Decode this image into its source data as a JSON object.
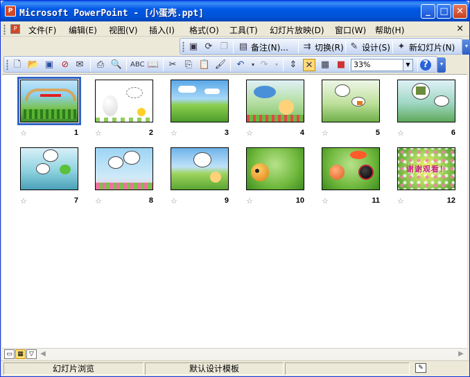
{
  "window": {
    "title": "Microsoft PowerPoint - [小蛋壳.ppt]",
    "icon": "powerpoint-icon",
    "controls": {
      "minimize": "_",
      "maximize": "□",
      "close": "✕"
    }
  },
  "menubar": {
    "items": [
      {
        "label": "文件(F)"
      },
      {
        "label": "编辑(E)"
      },
      {
        "label": "视图(V)"
      },
      {
        "label": "插入(I)"
      },
      {
        "label": "格式(O)"
      },
      {
        "label": "工具(T)"
      },
      {
        "label": "幻灯片放映(D)"
      },
      {
        "label": "窗口(W)"
      },
      {
        "label": "帮助(H)"
      }
    ],
    "close": "×"
  },
  "slide_sorter_toolbar": {
    "notes_label": "备注(N)...",
    "transition_label": "切换(R)",
    "design_label": "设计(S)",
    "new_slide_label": "新幻灯片(N)"
  },
  "standard_toolbar": {
    "zoom": "33%"
  },
  "slides": [
    {
      "number": "1",
      "scene": "meadow-title",
      "selected": true
    },
    {
      "number": "2",
      "scene": "egg-white"
    },
    {
      "number": "3",
      "scene": "sky-field"
    },
    {
      "number": "4",
      "scene": "cloud-egg"
    },
    {
      "number": "5",
      "scene": "bubbles-green"
    },
    {
      "number": "6",
      "scene": "bubbles-pond"
    },
    {
      "number": "7",
      "scene": "pond-frog"
    },
    {
      "number": "8",
      "scene": "flowers-bubbles"
    },
    {
      "number": "9",
      "scene": "sky-field-bubble"
    },
    {
      "number": "10",
      "scene": "grass-egg"
    },
    {
      "number": "11",
      "scene": "grass-ladybug"
    },
    {
      "number": "12",
      "scene": "thanks"
    }
  ],
  "slide12_text": "谢谢观看！",
  "statusbar": {
    "view": "幻灯片浏览",
    "template": "默认设计模板"
  },
  "colors": {
    "titlebar": "#0058e6",
    "selection": "#3163c5"
  }
}
